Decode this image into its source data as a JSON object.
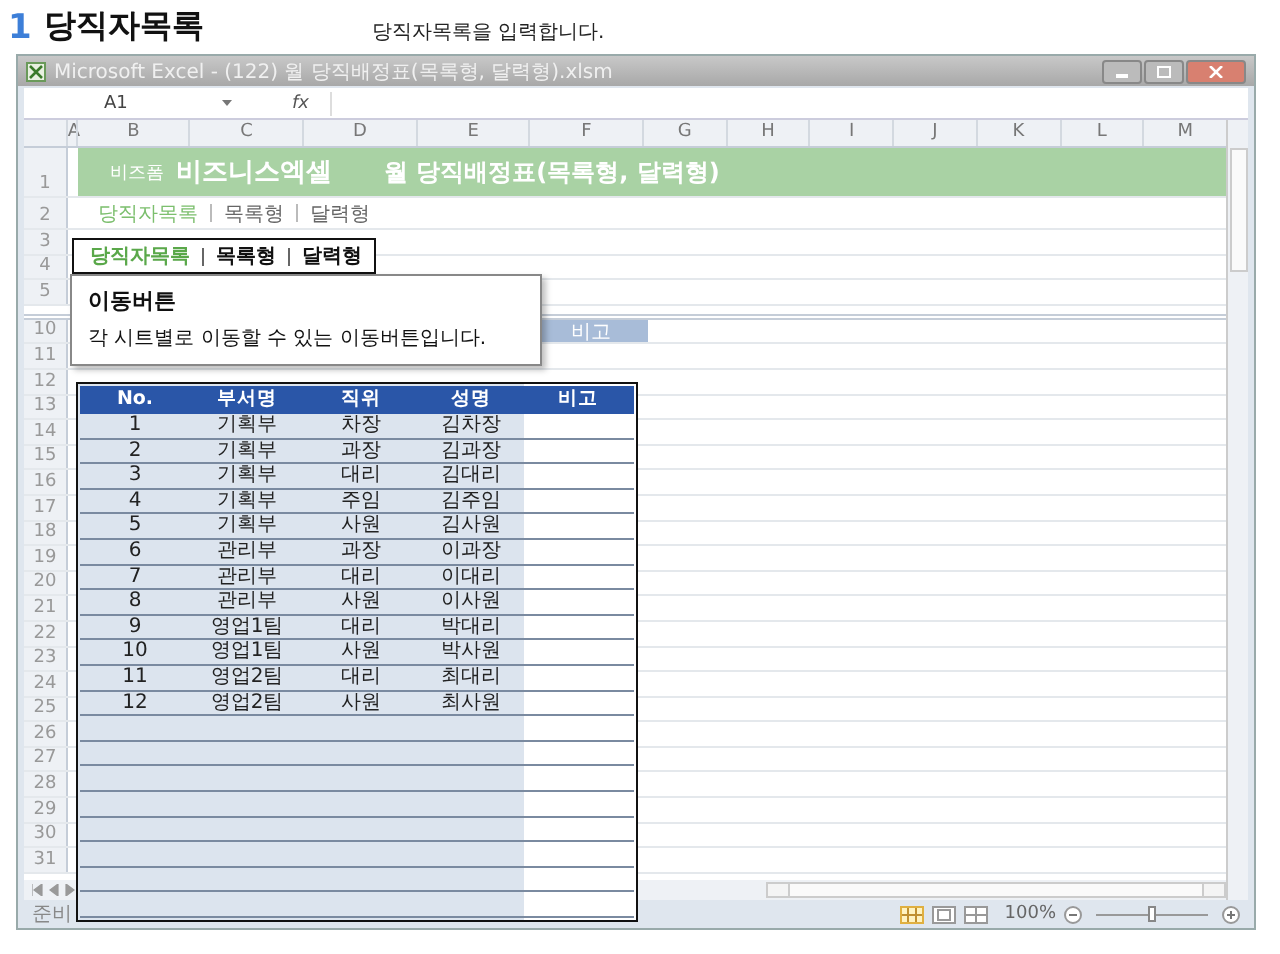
{
  "heading": {
    "number": "1",
    "title": "당직자목록"
  },
  "caption": "당직자목록을 입력합니다.",
  "window": {
    "title": "Microsoft Excel - (122) 월 당직배정표(목록형, 달력형).xlsm",
    "cell_ref": "A1",
    "formula_label": "fx"
  },
  "columns": [
    "A",
    "B",
    "C",
    "D",
    "E",
    "F",
    "G",
    "H",
    "I",
    "J",
    "K",
    "L",
    "M"
  ],
  "row_numbers": [
    "1",
    "2",
    "3",
    "4",
    "5",
    "10",
    "11",
    "12",
    "13",
    "14",
    "15",
    "16",
    "17",
    "18",
    "19",
    "20",
    "21",
    "22",
    "23",
    "24",
    "25",
    "26",
    "27",
    "28",
    "29",
    "30",
    "31"
  ],
  "banner": {
    "brand_small": "비즈폼",
    "brand": "비즈니스엑셀",
    "title": "월 당직배정표(목록형, 달력형)"
  },
  "sheet_links": [
    {
      "label": "당직자목록",
      "selected": true
    },
    {
      "label": "목록형",
      "selected": false
    },
    {
      "label": "달력형",
      "selected": false
    }
  ],
  "background_table": {
    "header": "비고"
  },
  "nav_box": {
    "links": [
      {
        "label": "당직자목록",
        "selected": true
      },
      {
        "label": "목록형",
        "selected": false
      },
      {
        "label": "달력형",
        "selected": false
      }
    ]
  },
  "callout": {
    "title": "이동버튼",
    "text": "각 시트별로 이동할 수 있는 이동버튼입니다."
  },
  "table": {
    "columns": [
      "No.",
      "부서명",
      "직위",
      "성명",
      "비고"
    ],
    "rows": [
      [
        "1",
        "기획부",
        "차장",
        "김차장"
      ],
      [
        "2",
        "기획부",
        "과장",
        "김과장"
      ],
      [
        "3",
        "기획부",
        "대리",
        "김대리"
      ],
      [
        "4",
        "기획부",
        "주임",
        "김주임"
      ],
      [
        "5",
        "기획부",
        "사원",
        "김사원"
      ],
      [
        "6",
        "관리부",
        "과장",
        "이과장"
      ],
      [
        "7",
        "관리부",
        "대리",
        "이대리"
      ],
      [
        "8",
        "관리부",
        "사원",
        "이사원"
      ],
      [
        "9",
        "영업1팀",
        "대리",
        "박대리"
      ],
      [
        "10",
        "영업1팀",
        "사원",
        "박사원"
      ],
      [
        "11",
        "영업2팀",
        "대리",
        "최대리"
      ],
      [
        "12",
        "영업2팀",
        "사원",
        "최사원"
      ]
    ]
  },
  "status_bar": {
    "status": "준비",
    "zoom": "100%",
    "zoom_slider": {
      "level": 0.5
    }
  }
}
